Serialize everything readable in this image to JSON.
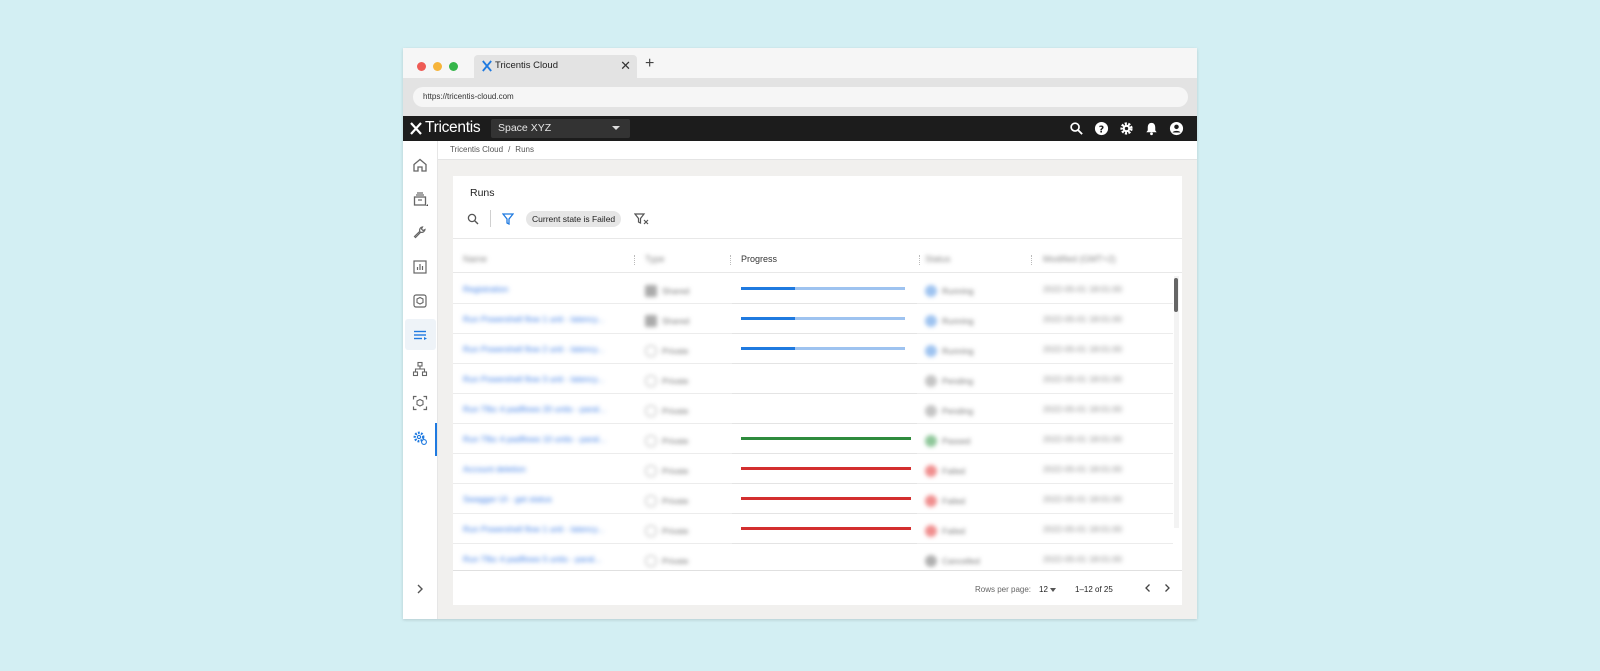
{
  "browser": {
    "tab_title": "Tricentis Cloud",
    "new_tab": "+",
    "close_tab": "✕",
    "url": "https://tricentis-cloud.com"
  },
  "app": {
    "brand": "Tricentis",
    "space": "Space XYZ"
  },
  "breadcrumb": {
    "root": "Tricentis Cloud",
    "separator": "/",
    "current": "Runs"
  },
  "runs": {
    "title": "Runs",
    "filter_chip": "Current state is Failed",
    "columns": {
      "name": "Name",
      "type": "Type",
      "progress": "Progress",
      "status": "Status",
      "modified": "Modified (GMT+2)"
    },
    "rows": [
      {
        "name": "Registration",
        "type": "Shared",
        "status": "Running",
        "modified": "2022-05-01 18:01:00",
        "progress": 0.33,
        "state": "running"
      },
      {
        "name": "Run Powershell flow 1 unit - latency...",
        "type": "Shared",
        "status": "Running",
        "modified": "2022-05-01 18:01:00",
        "progress": 0.33,
        "state": "running"
      },
      {
        "name": "Run Powershell flow 2 unit - latency...",
        "type": "Private",
        "status": "Running",
        "modified": "2022-05-01 18:01:00",
        "progress": 0.33,
        "state": "running"
      },
      {
        "name": "Run Powershell flow 3 unit - latency...",
        "type": "Private",
        "status": "Pending",
        "modified": "2022-05-01 18:01:00",
        "progress": 0,
        "state": "pending"
      },
      {
        "name": "Run Tfbc 4 padflows 20 units - paral...",
        "type": "Private",
        "status": "Pending",
        "modified": "2022-05-01 18:01:00",
        "progress": 0,
        "state": "pending"
      },
      {
        "name": "Run Tfbc 4 padflows 10 units - paral...",
        "type": "Private",
        "status": "Passed",
        "modified": "2022-05-01 18:01:00",
        "progress": 1,
        "state": "passed"
      },
      {
        "name": "Account deletion",
        "type": "Private",
        "status": "Failed",
        "modified": "2022-05-01 18:01:00",
        "progress": 1,
        "state": "failed"
      },
      {
        "name": "Swagger UI - get status",
        "type": "Private",
        "status": "Failed",
        "modified": "2022-05-01 18:01:00",
        "progress": 1,
        "state": "failed"
      },
      {
        "name": "Run Powershell flow 1 unit - latency...",
        "type": "Private",
        "status": "Failed",
        "modified": "2022-05-01 18:01:00",
        "progress": 1,
        "state": "failed"
      },
      {
        "name": "Run Tfbc 4 padflows 5 units - paral...",
        "type": "Private",
        "status": "Cancelled",
        "modified": "2022-05-01 18:01:00",
        "progress": 0,
        "state": "cancelled"
      }
    ],
    "pagination": {
      "rows_per_page_label": "Rows per page:",
      "rows_per_page": "12",
      "range": "1–12 of 25"
    }
  },
  "colors": {
    "running": "#1f7ae0",
    "running_track": "#9ec3f0",
    "passed": "#2e8b3d",
    "failed": "#d32f2f",
    "accent": "#1f7ae0",
    "header_bg": "#1c1c1c"
  }
}
